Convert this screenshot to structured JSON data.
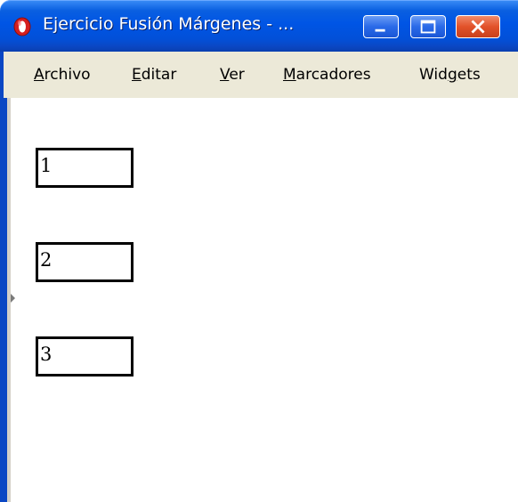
{
  "window": {
    "title": "Ejercicio Fusión Márgenes - ..."
  },
  "menu": {
    "items": [
      {
        "label_u": "A",
        "label_rest": "rchivo"
      },
      {
        "label_u": "E",
        "label_rest": "ditar"
      },
      {
        "label_u": "V",
        "label_rest": "er"
      },
      {
        "label_u": "M",
        "label_rest": "arcadores"
      },
      {
        "label_pre": "Wid",
        "label_u": "g",
        "label_rest": "ets"
      }
    ]
  },
  "content": {
    "boxes": [
      "1",
      "2",
      "3"
    ]
  },
  "colors": {
    "titlebar": "#0055e5",
    "menubar": "#ece9d8",
    "close_button": "#e2522a",
    "box_border": "#000000"
  },
  "icons": {
    "app": "opera-icon",
    "minimize": "minimize-icon",
    "maximize": "maximize-icon",
    "close": "close-icon"
  }
}
